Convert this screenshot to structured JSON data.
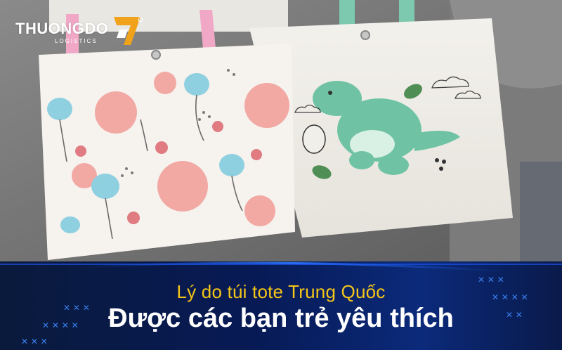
{
  "logo": {
    "name": "THUONGDO",
    "subtext": "LOGISTICS"
  },
  "banner": {
    "subtitle": "Lý do túi tote Trung Quốc",
    "title": "Được các bạn trẻ yêu thích"
  },
  "colors": {
    "banner_bg": "#071a55",
    "subtitle": "#f5c518",
    "title": "#ffffff",
    "accent_blue": "#2f7bff",
    "logo_orange": "#f0a21a"
  }
}
